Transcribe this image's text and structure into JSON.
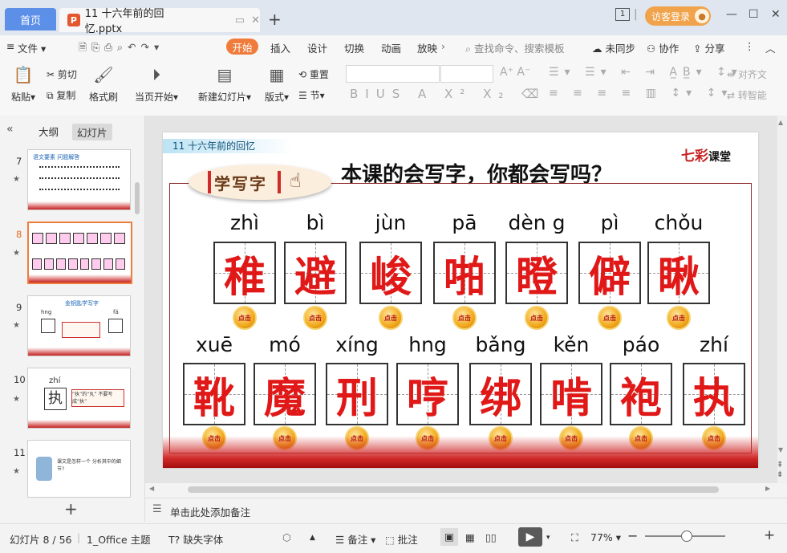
{
  "titlebar": {
    "home_tab": "首页",
    "doc_tab": "11 十六年前的回忆.pptx",
    "ppt_icon": "P",
    "login": "访客登录",
    "badge": "1"
  },
  "menu": {
    "file": "文件",
    "start": "开始",
    "items": [
      "插入",
      "设计",
      "切换",
      "动画",
      "放映"
    ],
    "search": "查找命令、搜索模板",
    "sync": "未同步",
    "collab": "协作",
    "share": "分享"
  },
  "ribbon": {
    "paste": "粘贴",
    "cut": "剪切",
    "copy": "复制",
    "format_painter": "格式刷",
    "play_current": "当页开始",
    "new_slide": "新建幻灯片",
    "layout": "版式",
    "reset": "重置",
    "section": "节",
    "align_text": "对齐文",
    "to_smartart": "转智能"
  },
  "left_pane": {
    "tab_outline": "大纲",
    "tab_slides": "幻灯片",
    "slides": [
      {
        "num": "7",
        "selected": false
      },
      {
        "num": "8",
        "selected": true
      },
      {
        "num": "9",
        "selected": false
      },
      {
        "num": "10",
        "selected": false
      },
      {
        "num": "11",
        "selected": false
      }
    ],
    "thumb7_title": "语文要素 问题解答",
    "thumb9_text": "金钥匙学写字",
    "thumb10_pinyin": "zhí",
    "thumb10_char": "执",
    "thumb10_note": "“执”的“丸” 不要写成“执”",
    "thumb9_pinyin_left": "hng",
    "thumb9_pinyin_right": "fá",
    "thumb11_text": "课文是怎样一个 分析其中的细节?",
    "add_slide": "+"
  },
  "slide": {
    "tag": "11  十六年前的回忆",
    "title": "本课的会写字，你都会写吗？",
    "brand_red": "七彩",
    "brand_black": "课堂",
    "xxz": "学写字",
    "coin_label": "点击",
    "row1": [
      {
        "pinyin": "zhì",
        "char": "稚"
      },
      {
        "pinyin": "bì",
        "char": "避"
      },
      {
        "pinyin": "jùn",
        "char": "峻"
      },
      {
        "pinyin": "pā",
        "char": "啪"
      },
      {
        "pinyin": "dèn g",
        "char": "瞪"
      },
      {
        "pinyin": "pì",
        "char": "僻"
      },
      {
        "pinyin": "chǒu",
        "char": "瞅"
      }
    ],
    "row2": [
      {
        "pinyin": "xuē",
        "char": "靴"
      },
      {
        "pinyin": "mó",
        "char": "魔"
      },
      {
        "pinyin": "xíng",
        "char": "刑"
      },
      {
        "pinyin": "hng",
        "char": "哼"
      },
      {
        "pinyin": "bǎng",
        "char": "绑"
      },
      {
        "pinyin": "kěn",
        "char": "啃"
      },
      {
        "pinyin": "páo",
        "char": "袍"
      },
      {
        "pinyin": "zhí",
        "char": "执"
      }
    ]
  },
  "notes": {
    "placeholder": "单击此处添加备注"
  },
  "status": {
    "slide_index": "幻灯片 8 / 56",
    "theme": "1_Office 主题",
    "missing_font": "缺失字体",
    "notes": "备注",
    "comment": "批注",
    "zoom": "77%"
  }
}
